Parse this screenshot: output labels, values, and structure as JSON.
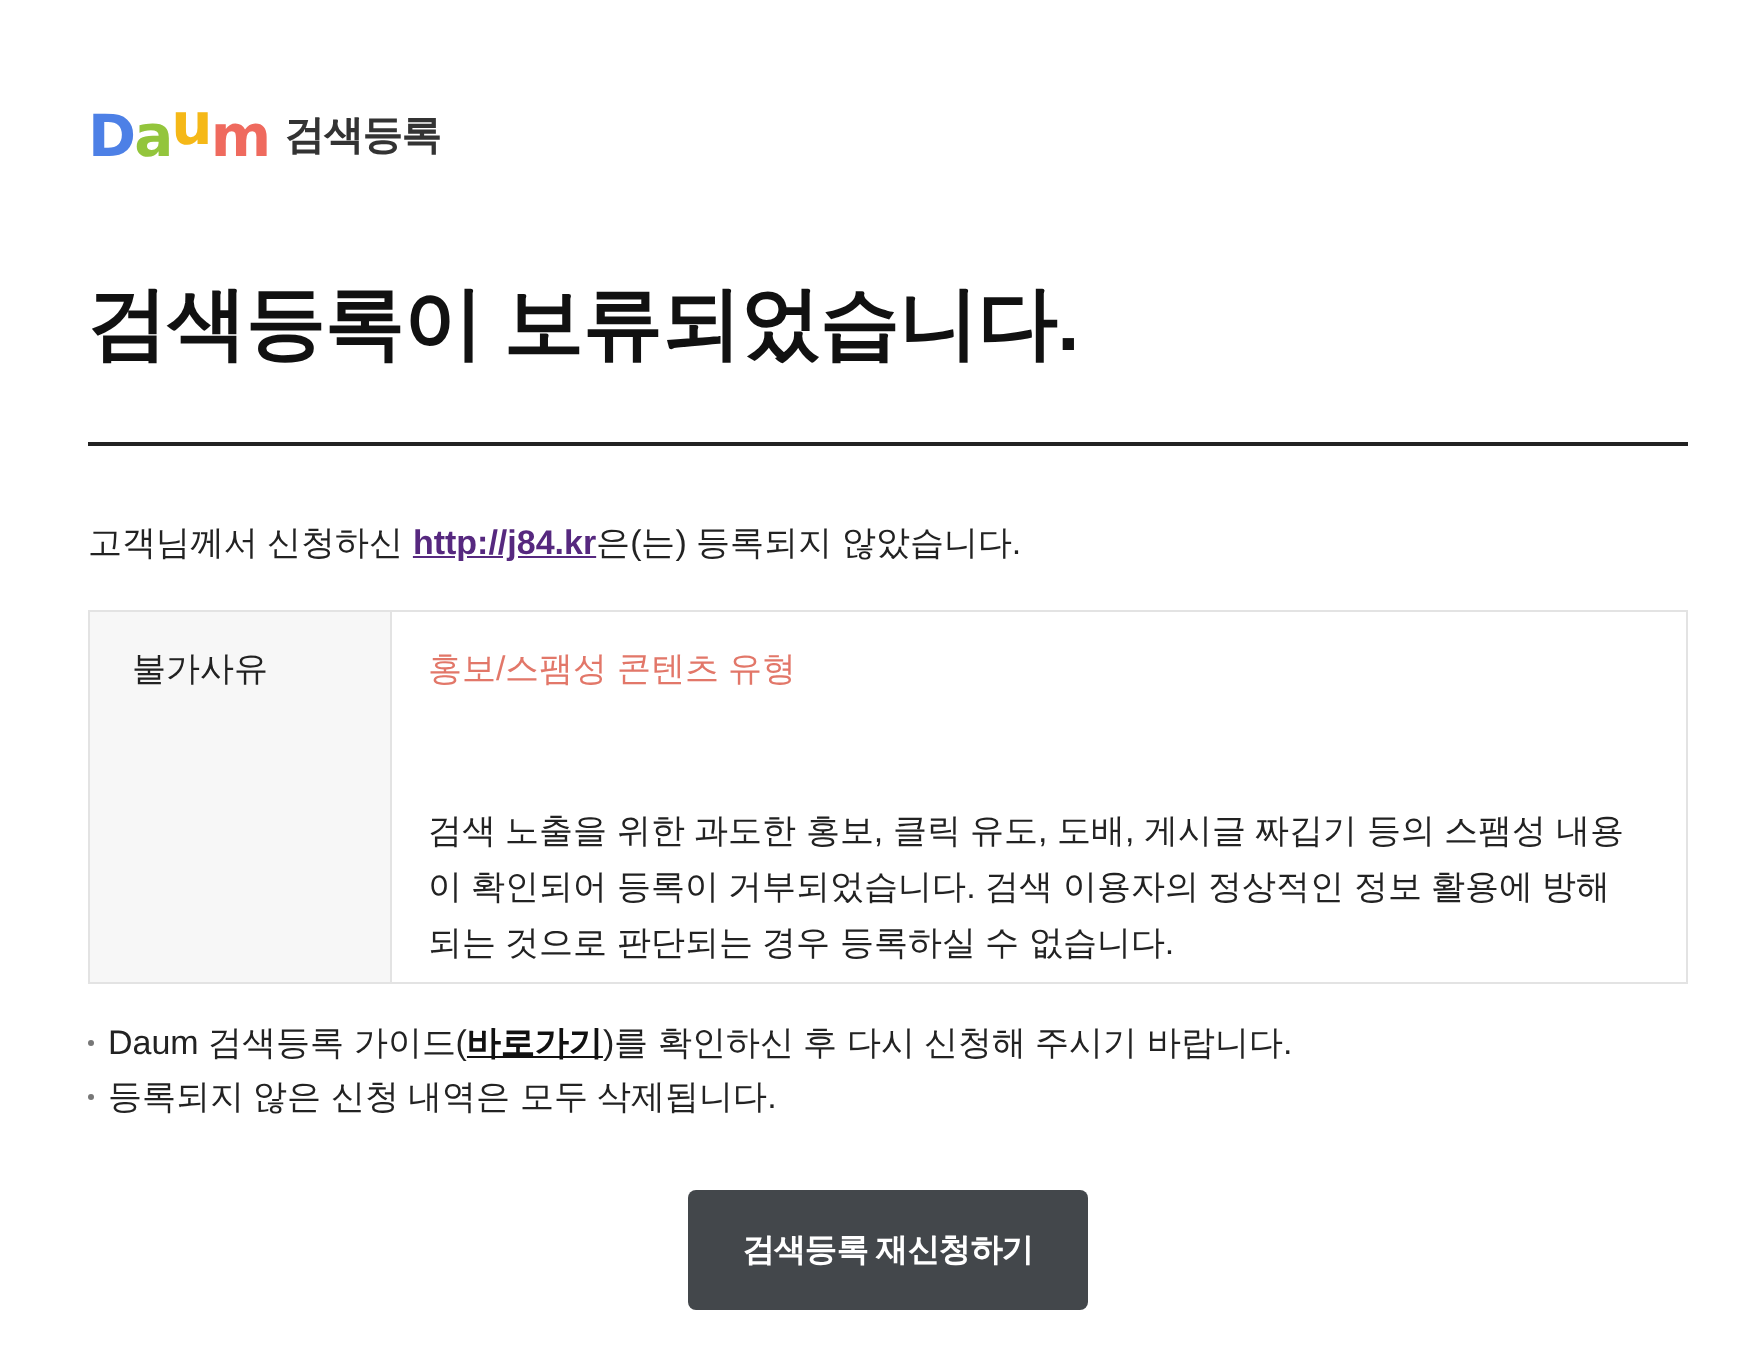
{
  "logo": {
    "wordmark": [
      {
        "char": "D",
        "color": "#4d80e6"
      },
      {
        "char": "a",
        "color": "#93c53c"
      },
      {
        "char": "u",
        "color": "#f5b817"
      },
      {
        "char": "m",
        "color": "#ef6a5e"
      }
    ],
    "service": "검색등록"
  },
  "title": "검색등록이 보류되었습니다.",
  "notice": {
    "before": "고객님께서 신청하신 ",
    "link": "http://j84.kr",
    "after": "은(는) 등록되지 않았습니다."
  },
  "reason": {
    "label": "불가사유",
    "type": "홍보/스팸성 콘텐츠 유형",
    "description": "검색 노출을 위한 과도한 홍보, 클릭 유도, 도배, 게시글 짜깁기 등의 스팸성 내용이 확인되어 등록이 거부되었습니다. 검색 이용자의 정상적인 정보 활용에 방해되는 것으로 판단되는 경우 등록하실 수 없습니다."
  },
  "notes": [
    {
      "kind": "link",
      "before": "Daum 검색등록 가이드(",
      "link": "바로가기",
      "after": ")를 확인하신 후 다시 신청해 주시기 바랍니다."
    },
    {
      "kind": "plain",
      "text": "등록되지 않은 신청 내역은 모두 삭제됩니다."
    }
  ],
  "button": "검색등록 재신청하기"
}
